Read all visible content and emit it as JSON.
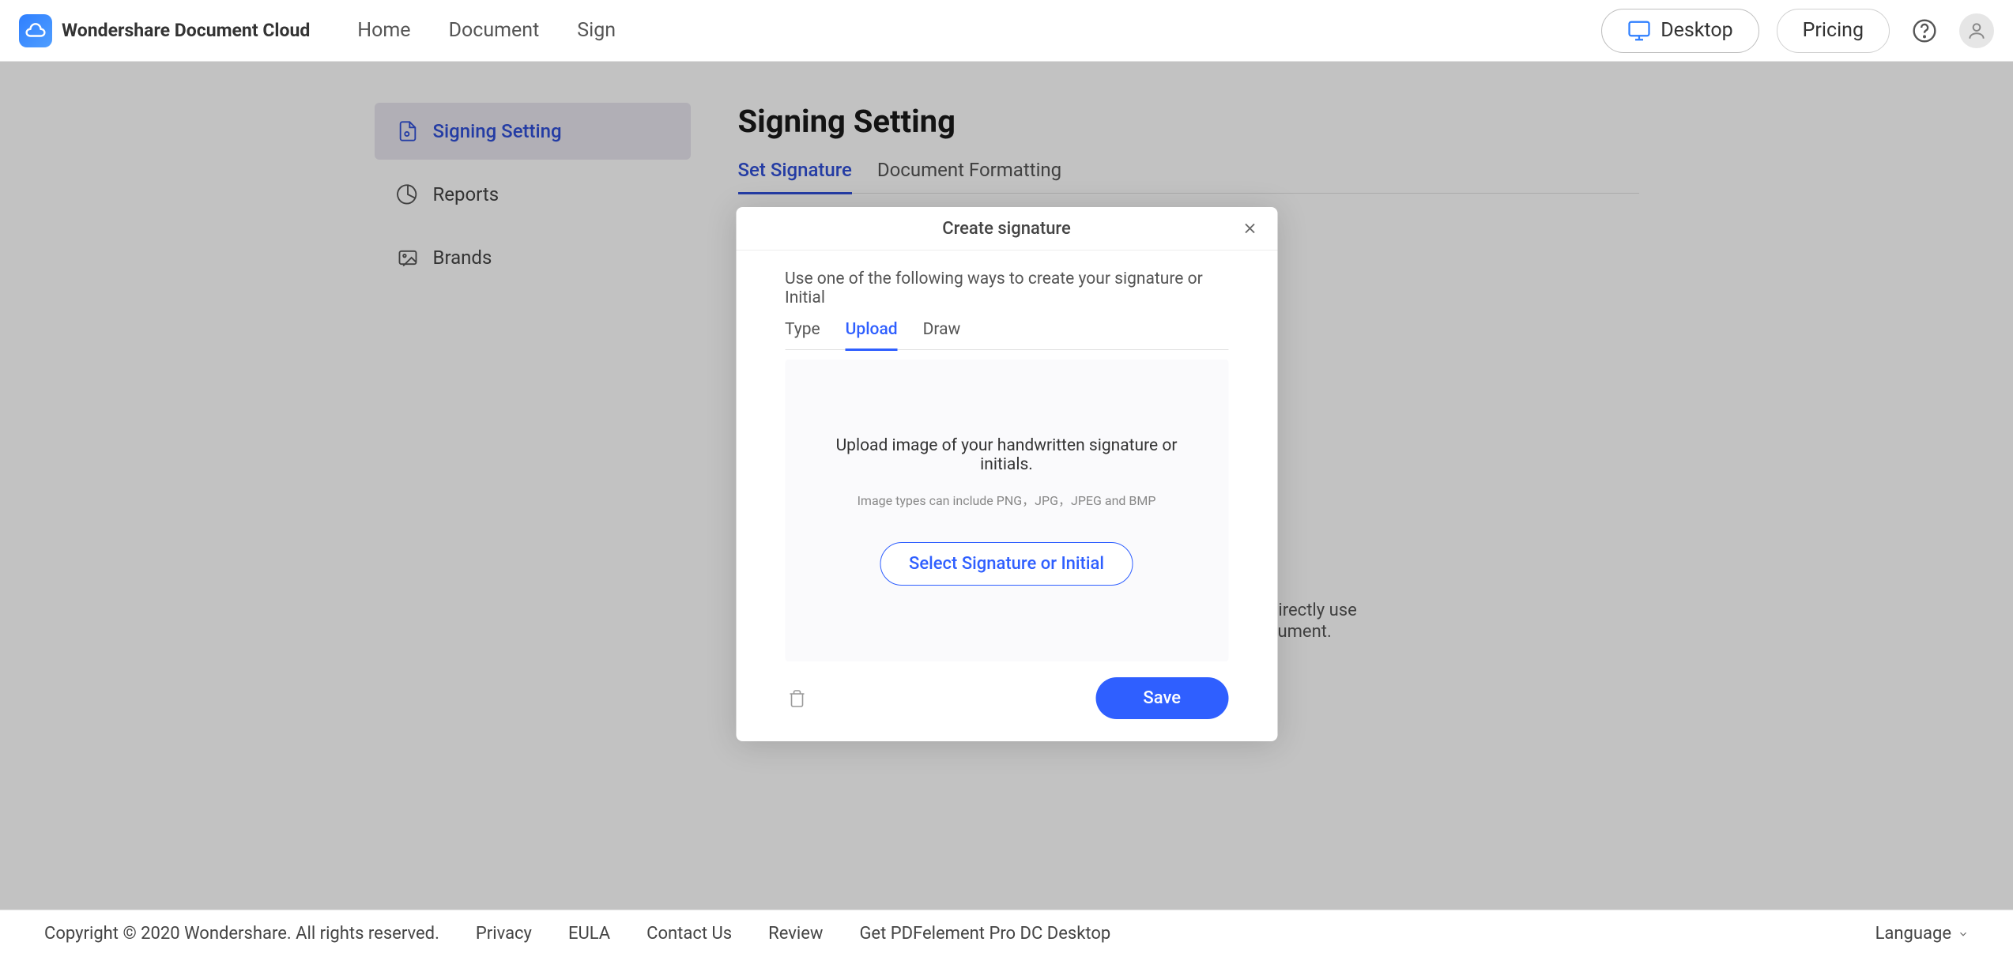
{
  "brand": "Wondershare Document Cloud",
  "top_nav": {
    "home": "Home",
    "document": "Document",
    "sign": "Sign"
  },
  "header_actions": {
    "desktop": "Desktop",
    "pricing": "Pricing"
  },
  "sidebar": {
    "signing_setting": "Signing Setting",
    "reports": "Reports",
    "brands": "Brands"
  },
  "main": {
    "title": "Signing Setting",
    "tabs": {
      "set_signature": "Set Signature",
      "doc_fmt": "Document Formatting"
    },
    "bg_text_line1": "directly use",
    "bg_text_line2": "cument."
  },
  "modal": {
    "title": "Create signature",
    "desc": "Use one of the following ways to create your signature or Initial",
    "tabs": {
      "type": "Type",
      "upload": "Upload",
      "draw": "Draw"
    },
    "upload": {
      "line1": "Upload image of your handwritten signature or initials.",
      "line2": "Image types can include PNG，JPG，JPEG and BMP",
      "select_btn": "Select Signature or Initial"
    },
    "save": "Save"
  },
  "footer": {
    "copyright": "Copyright © 2020 Wondershare. All rights reserved.",
    "links": {
      "privacy": "Privacy",
      "eula": "EULA",
      "contact": "Contact Us",
      "review": "Review",
      "get_desktop": "Get PDFelement Pro DC Desktop"
    },
    "language": "Language"
  }
}
